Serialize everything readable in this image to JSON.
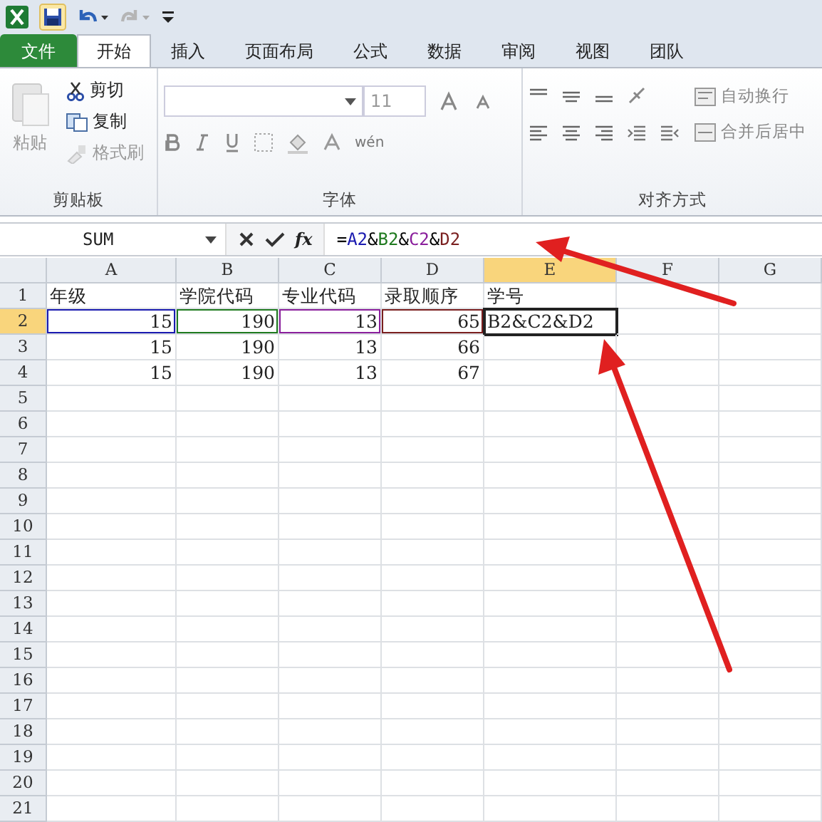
{
  "quick_access": {
    "items": [
      {
        "kind": "app"
      },
      {
        "kind": "save"
      },
      {
        "kind": "undo"
      },
      {
        "kind": "redo"
      },
      {
        "kind": "customize"
      }
    ]
  },
  "tabs": [
    {
      "label": "文件",
      "kind": "file",
      "selected": false
    },
    {
      "label": "开始",
      "kind": "tab",
      "selected": true
    },
    {
      "label": "插入",
      "kind": "tab",
      "selected": false
    },
    {
      "label": "页面布局",
      "kind": "tab",
      "selected": false
    },
    {
      "label": "公式",
      "kind": "tab",
      "selected": false
    },
    {
      "label": "数据",
      "kind": "tab",
      "selected": false
    },
    {
      "label": "审阅",
      "kind": "tab",
      "selected": false
    },
    {
      "label": "视图",
      "kind": "tab",
      "selected": false
    },
    {
      "label": "团队",
      "kind": "tab",
      "selected": false
    }
  ],
  "ribbon": {
    "clipboard": {
      "title": "剪贴板",
      "paste": {
        "label": "粘贴",
        "disabled": true
      },
      "items": [
        {
          "label": "剪切",
          "kind": "cut",
          "disabled": false
        },
        {
          "label": "复制",
          "kind": "copy",
          "disabled": false
        },
        {
          "label": "格式刷",
          "kind": "brush",
          "disabled": true
        }
      ]
    },
    "font": {
      "title": "字体",
      "size": "11",
      "phonetic": "wén"
    },
    "alignment": {
      "title": "对齐方式",
      "items": [
        {
          "label": "自动换行",
          "kind": "wrap"
        },
        {
          "label": "合并后居中",
          "kind": "merge"
        }
      ]
    }
  },
  "formula_bar": {
    "name_box": "SUM",
    "fx": "fx",
    "parts": [
      {
        "text": "=",
        "color": "#000000"
      },
      {
        "text": "A2",
        "color": "#1a1ab0"
      },
      {
        "text": "&",
        "color": "#000000"
      },
      {
        "text": "B2",
        "color": "#1f7a1f"
      },
      {
        "text": "&",
        "color": "#000000"
      },
      {
        "text": "C2",
        "color": "#8a1f9c"
      },
      {
        "text": "&",
        "color": "#000000"
      },
      {
        "text": "D2",
        "color": "#7a1f1f"
      }
    ]
  },
  "columns": [
    {
      "label": "A",
      "selected": false
    },
    {
      "label": "B",
      "selected": false
    },
    {
      "label": "C",
      "selected": false
    },
    {
      "label": "D",
      "selected": false
    },
    {
      "label": "E",
      "selected": true
    },
    {
      "label": "F",
      "selected": false
    },
    {
      "label": "G",
      "selected": false
    }
  ],
  "rows": [
    {
      "number": "1",
      "selected": false,
      "cells": [
        {
          "text": "年级",
          "kind": "text",
          "selected": false
        },
        {
          "text": "学院代码",
          "kind": "text",
          "selected": false
        },
        {
          "text": "专业代码",
          "kind": "text",
          "selected": false
        },
        {
          "text": "录取顺序",
          "kind": "text",
          "selected": false
        },
        {
          "text": "学号",
          "kind": "text",
          "selected": false
        }
      ]
    },
    {
      "number": "2",
      "selected": true,
      "cells": [
        {
          "text": "15",
          "kind": "number",
          "selected": false,
          "color": "#1a1ab0"
        },
        {
          "text": "190",
          "kind": "number",
          "selected": false,
          "color": "#1f7a1f"
        },
        {
          "text": "13",
          "kind": "number",
          "selected": false,
          "color": "#8a1f9c"
        },
        {
          "text": "65",
          "kind": "number",
          "selected": false,
          "color": "#7a1f1f"
        },
        {
          "text": "B2&C2&D2",
          "kind": "text",
          "selected": true
        }
      ]
    },
    {
      "number": "3",
      "selected": false,
      "cells": [
        {
          "text": "15",
          "kind": "number",
          "selected": false
        },
        {
          "text": "190",
          "kind": "number",
          "selected": false
        },
        {
          "text": "13",
          "kind": "number",
          "selected": false
        },
        {
          "text": "66",
          "kind": "number",
          "selected": false
        }
      ]
    },
    {
      "number": "4",
      "selected": false,
      "cells": [
        {
          "text": "15",
          "kind": "number",
          "selected": false
        },
        {
          "text": "190",
          "kind": "number",
          "selected": false
        },
        {
          "text": "13",
          "kind": "number",
          "selected": false
        },
        {
          "text": "67",
          "kind": "number",
          "selected": false
        }
      ]
    },
    {
      "number": "5",
      "selected": false
    },
    {
      "number": "6",
      "selected": false
    },
    {
      "number": "7",
      "selected": false
    },
    {
      "number": "8",
      "selected": false
    },
    {
      "number": "9",
      "selected": false
    },
    {
      "number": "10",
      "selected": false
    },
    {
      "number": "11",
      "selected": false
    },
    {
      "number": "12",
      "selected": false
    },
    {
      "number": "13",
      "selected": false
    },
    {
      "number": "14",
      "selected": false
    },
    {
      "number": "15",
      "selected": false
    },
    {
      "number": "16",
      "selected": false
    },
    {
      "number": "17",
      "selected": false
    },
    {
      "number": "18",
      "selected": false
    },
    {
      "number": "19",
      "selected": false
    },
    {
      "number": "20",
      "selected": false
    },
    {
      "number": "21",
      "selected": false
    }
  ]
}
